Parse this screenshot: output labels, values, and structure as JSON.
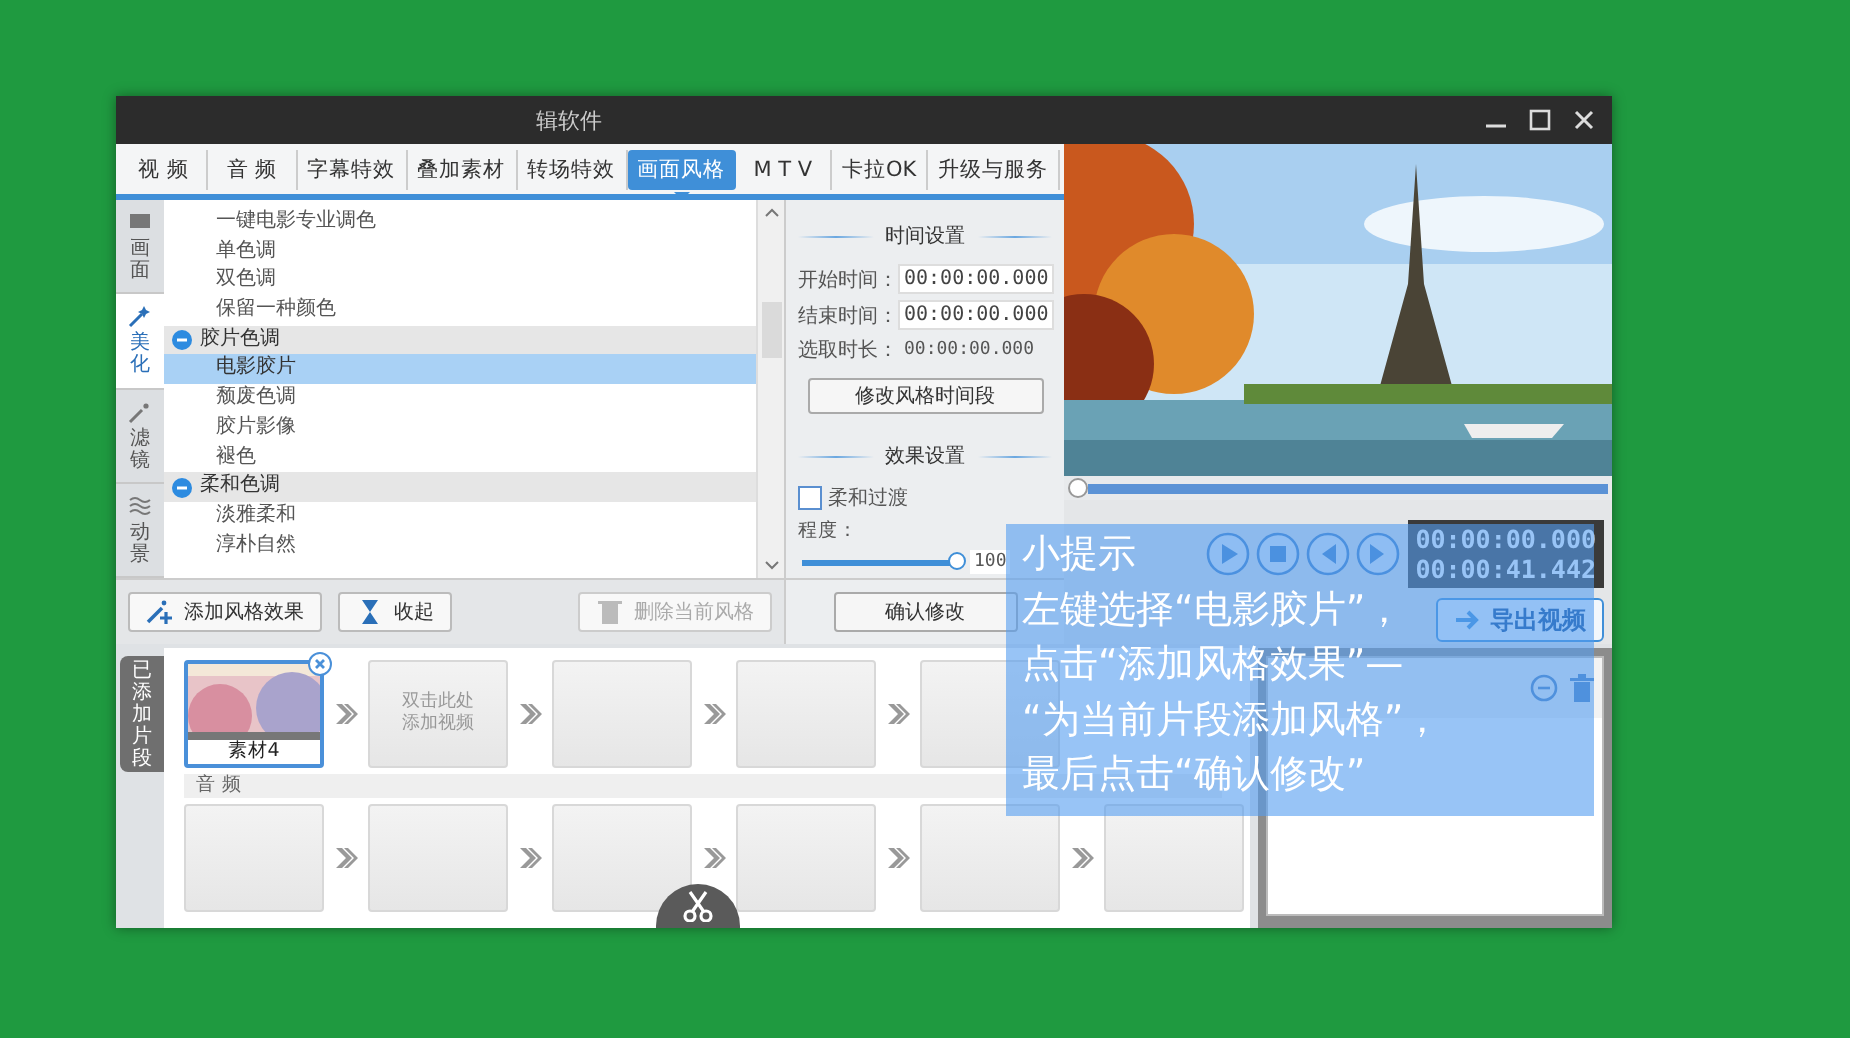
{
  "window": {
    "title": "辑软件"
  },
  "tabs": [
    {
      "label": "视 频",
      "selected": false
    },
    {
      "label": "音 频",
      "selected": false
    },
    {
      "label": "字幕特效",
      "selected": false
    },
    {
      "label": "叠加素材",
      "selected": false
    },
    {
      "label": "转场特效",
      "selected": false
    },
    {
      "label": "画面风格",
      "selected": true
    },
    {
      "label": "M T V",
      "selected": false
    },
    {
      "label": "卡拉OK",
      "selected": false
    },
    {
      "label": "升级与服务",
      "selected": false
    }
  ],
  "side_tabs": [
    {
      "label": "画面",
      "selected": false
    },
    {
      "label": "美化",
      "selected": true
    },
    {
      "label": "滤镜",
      "selected": false
    },
    {
      "label": "动景",
      "selected": false
    }
  ],
  "style_list": [
    {
      "kind": "item",
      "label": "一键电影专业调色",
      "selected": false
    },
    {
      "kind": "item",
      "label": "单色调",
      "selected": false
    },
    {
      "kind": "item",
      "label": "双色调",
      "selected": false
    },
    {
      "kind": "item",
      "label": "保留一种颜色",
      "selected": false
    },
    {
      "kind": "group",
      "label": "胶片色调",
      "expanded": true,
      "children": [
        {
          "kind": "item",
          "label": "电影胶片",
          "selected": true
        },
        {
          "kind": "item",
          "label": "颓废色调",
          "selected": false
        },
        {
          "kind": "item",
          "label": "胶片影像",
          "selected": false
        },
        {
          "kind": "item",
          "label": "褪色",
          "selected": false
        }
      ]
    },
    {
      "kind": "group",
      "label": "柔和色调",
      "expanded": true,
      "children": [
        {
          "kind": "item",
          "label": "淡雅柔和",
          "selected": false
        },
        {
          "kind": "item",
          "label": "淳朴自然",
          "selected": false
        }
      ]
    }
  ],
  "list_buttons": [
    {
      "label": "添加风格效果",
      "disabled": false
    },
    {
      "label": "收起",
      "disabled": false
    },
    {
      "label": "删除当前风格",
      "disabled": true
    }
  ],
  "time_settings": {
    "heading": "时间设置",
    "start": {
      "label": "开始时间：",
      "value": "00:00:00.000"
    },
    "end": {
      "label": "结束时间：",
      "value": "00:00:00.000"
    },
    "duration": {
      "label": "选取时长：",
      "value": "00:00:00.000"
    },
    "button": "修改风格时间段"
  },
  "effect_settings": {
    "heading": "效果设置",
    "smooth": {
      "label": "柔和过渡",
      "checked": false
    },
    "strength": {
      "label": "程度：",
      "level": 1,
      "value": "100"
    }
  },
  "confirm_button": "确认修改",
  "preview": {
    "progress": {
      "level": 0
    },
    "current_time": "00:00:00.000",
    "total_time": "00:00:41.442",
    "export_button": "导出视频"
  },
  "timeline": {
    "tab": "已添加片段",
    "video_clips": [
      {
        "kind": "clip",
        "label": "素材4",
        "selected": true
      },
      {
        "kind": "empty",
        "placeholder": "双击此处添加视频"
      },
      {
        "kind": "empty"
      },
      {
        "kind": "empty"
      },
      {
        "kind": "empty"
      }
    ],
    "audio_label": "音 频",
    "audio_slots": [
      {
        "kind": "empty"
      },
      {
        "kind": "empty"
      },
      {
        "kind": "empty"
      },
      {
        "kind": "empty"
      },
      {
        "kind": "empty"
      },
      {
        "kind": "empty"
      }
    ]
  },
  "tip": {
    "title": "小提示",
    "lines": [
      "左键选择“电影胶片”，",
      "点击“添加风格效果”—",
      "“为当前片段添加风格”，",
      "最后点击“确认修改”"
    ]
  }
}
